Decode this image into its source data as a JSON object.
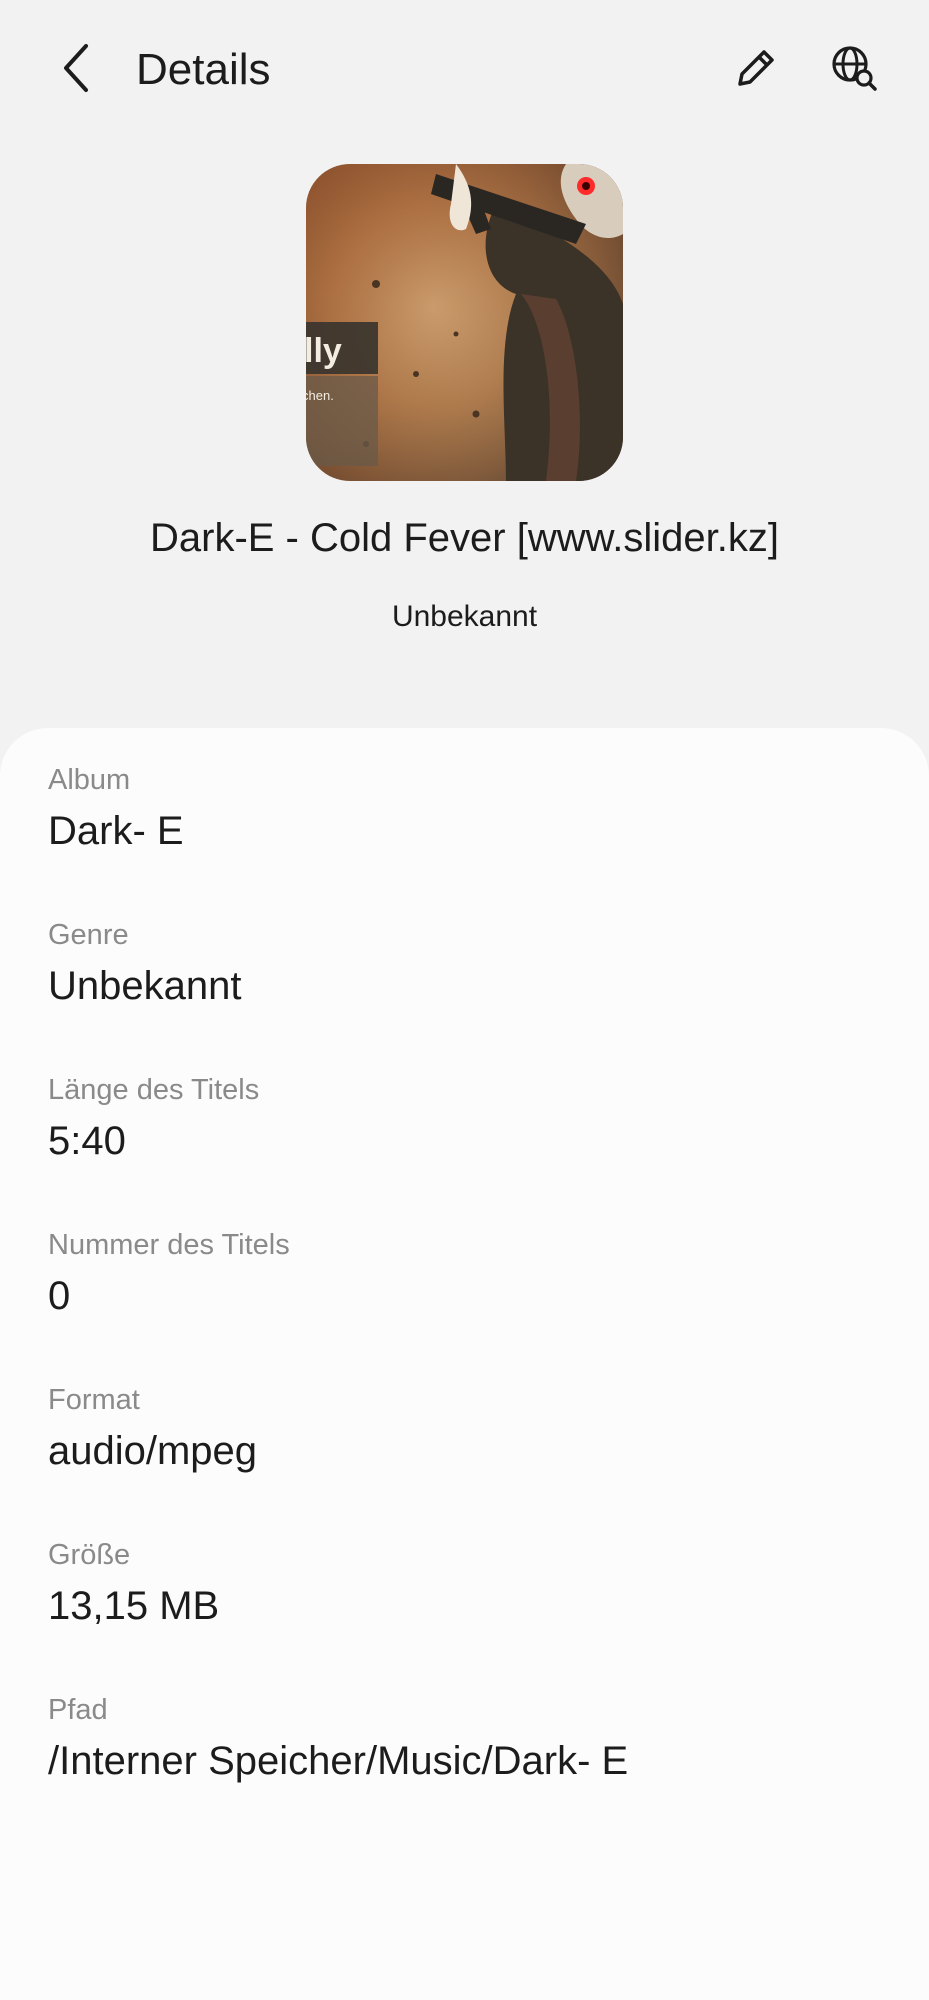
{
  "header": {
    "title": "Details",
    "back_icon": "chevron-left-icon",
    "edit_icon": "pencil-icon",
    "web_search_icon": "globe-search-icon"
  },
  "album_art": {
    "text_large": "lly",
    "text_small": "chen."
  },
  "song": {
    "title": "Dark-E - Cold Fever [www.slider.kz]",
    "artist": "Unbekannt"
  },
  "details": [
    {
      "label": "Album",
      "value": "Dark- E"
    },
    {
      "label": "Genre",
      "value": "Unbekannt"
    },
    {
      "label": "Länge des Titels",
      "value": "5:40"
    },
    {
      "label": "Nummer des Titels",
      "value": "0"
    },
    {
      "label": "Format",
      "value": "audio/mpeg"
    },
    {
      "label": "Größe",
      "value": "13,15 MB"
    },
    {
      "label": "Pfad",
      "value": "/Interner Speicher/Music/Dark- E"
    }
  ],
  "colors": {
    "background": "#f2f2f2",
    "card": "#fcfcfc",
    "label": "#8a8a8a",
    "text": "#1c1c1c"
  }
}
